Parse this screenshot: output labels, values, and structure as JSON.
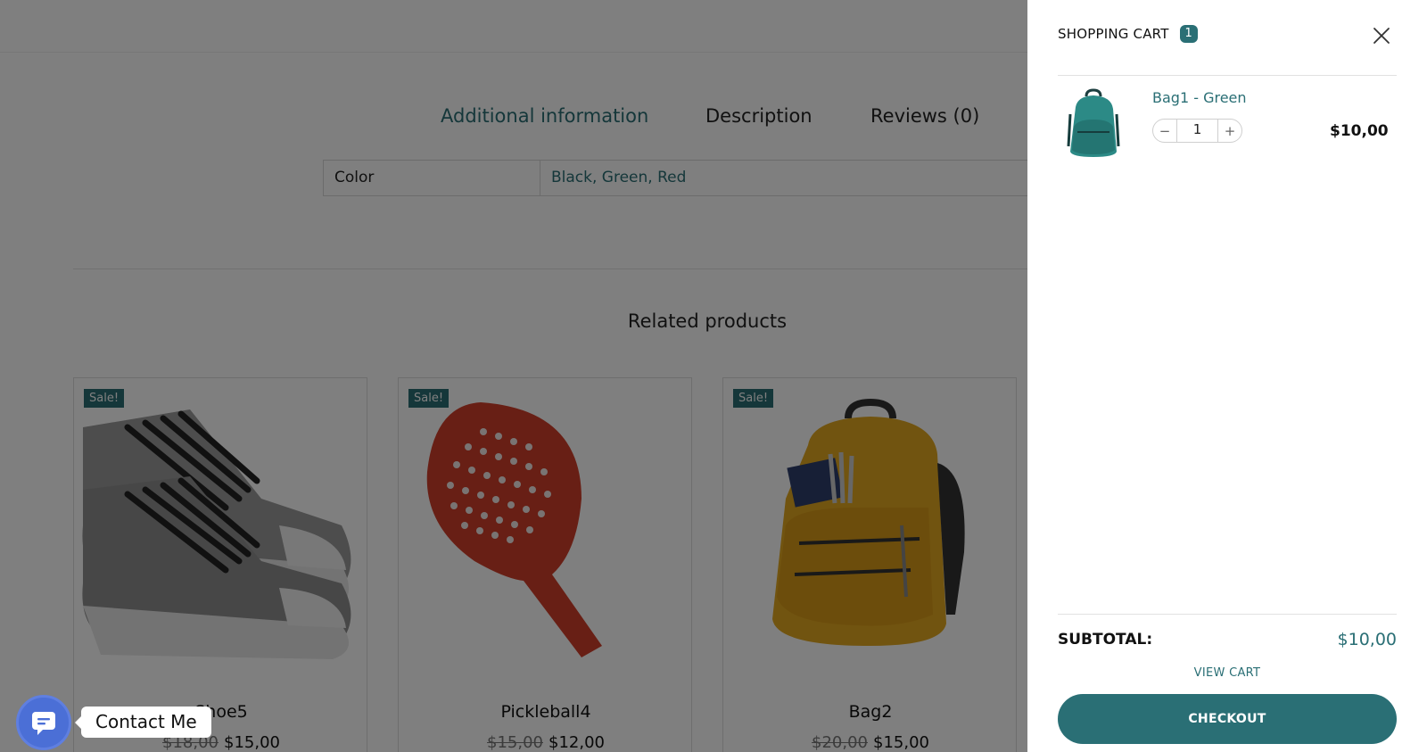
{
  "tabs": [
    {
      "label": "Additional information",
      "active": true
    },
    {
      "label": "Description",
      "active": false
    },
    {
      "label": "Reviews (0)",
      "active": false
    }
  ],
  "attributes": {
    "name": "Color",
    "value": "Black, Green, Red"
  },
  "related": {
    "title": "Related products",
    "products": [
      {
        "sale_badge": "Sale!",
        "name": "Shoe5",
        "old_price": "$18,00",
        "price": "$15,00"
      },
      {
        "sale_badge": "Sale!",
        "name": "Pickleball4",
        "old_price": "$15,00",
        "price": "$12,00"
      },
      {
        "sale_badge": "Sale!",
        "name": "Bag2",
        "old_price": "$20,00",
        "price": "$15,00"
      }
    ]
  },
  "contact": {
    "label": "Contact Me",
    "icon": "chat-icon"
  },
  "cart": {
    "title": "SHOPPING CART",
    "count": "1",
    "items": [
      {
        "name": "Bag1 - Green",
        "quantity": "1",
        "price": "$10,00",
        "icon": "backpack-icon"
      }
    ],
    "subtotal_label": "SUBTOTAL:",
    "subtotal_value": "$10,00",
    "view_cart_label": "VIEW CART",
    "checkout_label": "CHECKOUT"
  },
  "colors": {
    "accent": "#2a6f75",
    "contact_button": "#4b6fd6",
    "overlay": "rgba(0,0,0,0.5)"
  }
}
